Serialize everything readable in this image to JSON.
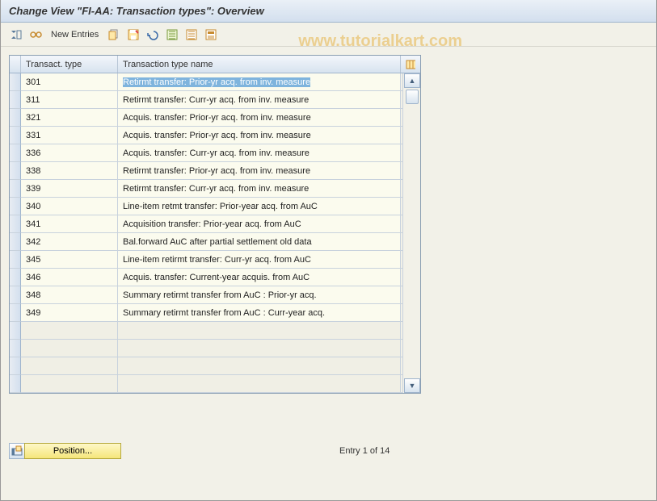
{
  "title": "Change View \"FI-AA: Transaction types\": Overview",
  "toolbar": {
    "new_entries": "New Entries"
  },
  "watermark": "www.tutorialkart.com",
  "columns": {
    "c1": "Transact. type",
    "c2": "Transaction type name"
  },
  "rows": [
    {
      "type": "301",
      "name": "Retirmt transfer: Prior-yr acq. from inv. measure",
      "selected": true
    },
    {
      "type": "311",
      "name": "Retirmt transfer: Curr-yr acq. from inv. measure"
    },
    {
      "type": "321",
      "name": "Acquis. transfer: Prior-yr acq. from inv. measure"
    },
    {
      "type": "331",
      "name": "Acquis. transfer: Prior-yr acq. from inv. measure"
    },
    {
      "type": "336",
      "name": "Acquis. transfer: Curr-yr acq. from inv. measure"
    },
    {
      "type": "338",
      "name": "Retirmt transfer: Prior-yr acq. from inv. measure"
    },
    {
      "type": "339",
      "name": "Retirmt transfer: Curr-yr acq. from inv. measure"
    },
    {
      "type": "340",
      "name": "Line-item retmt transfer: Prior-year acq. from AuC"
    },
    {
      "type": "341",
      "name": "Acquisition transfer: Prior-year acq. from AuC"
    },
    {
      "type": "342",
      "name": "Bal.forward AuC after partial settlement old data"
    },
    {
      "type": "345",
      "name": "Line-item retirmt transfer: Curr-yr acq. from AuC"
    },
    {
      "type": "346",
      "name": "Acquis. transfer: Current-year acquis. from AuC"
    },
    {
      "type": "348",
      "name": "Summary retirmt transfer from AuC : Prior-yr acq."
    },
    {
      "type": "349",
      "name": "Summary retirmt transfer from AuC : Curr-year acq."
    }
  ],
  "empty_rows": 4,
  "footer": {
    "position_label": "Position...",
    "entry_text": "Entry 1 of 14"
  }
}
